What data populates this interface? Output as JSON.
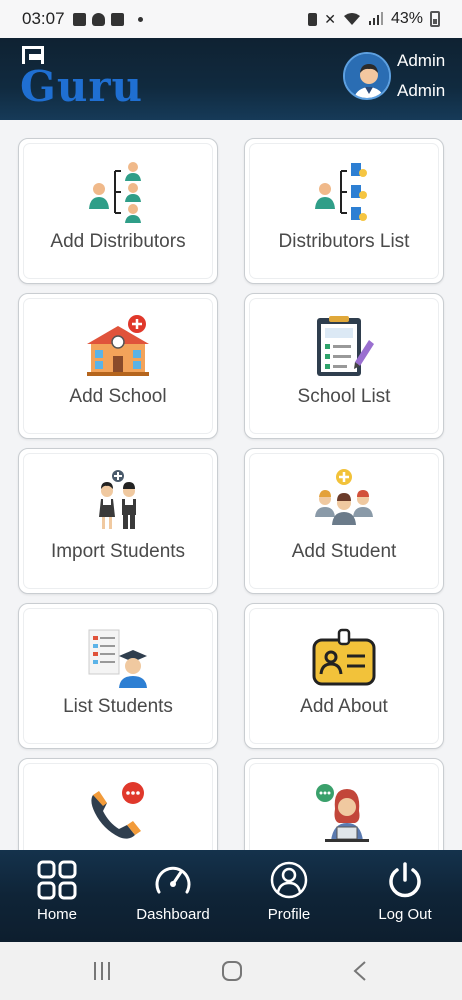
{
  "status_bar": {
    "time": "03:07",
    "battery": "43%"
  },
  "header": {
    "brand": "Guru",
    "user_name": "Admin",
    "user_role": "Admin"
  },
  "cards": [
    {
      "label": "Add Distributors",
      "icon": "add-distributors-icon"
    },
    {
      "label": "Distributors List",
      "icon": "distributors-list-icon"
    },
    {
      "label": "Add School",
      "icon": "add-school-icon"
    },
    {
      "label": "School List",
      "icon": "school-list-icon"
    },
    {
      "label": "Import Students",
      "icon": "import-students-icon"
    },
    {
      "label": "Add Student",
      "icon": "add-student-icon"
    },
    {
      "label": "List Students",
      "icon": "list-students-icon"
    },
    {
      "label": "Add About",
      "icon": "add-about-icon"
    },
    {
      "label": "",
      "icon": "contact-phone-icon"
    },
    {
      "label": "",
      "icon": "support-agent-icon"
    }
  ],
  "bottom_nav": [
    {
      "label": "Home",
      "icon": "home-grid-icon"
    },
    {
      "label": "Dashboard",
      "icon": "dashboard-gauge-icon"
    },
    {
      "label": "Profile",
      "icon": "profile-icon"
    },
    {
      "label": "Log Out",
      "icon": "power-icon"
    }
  ],
  "colors": {
    "header": "#102a3f",
    "brand": "#1f6fd2",
    "nav": "#0f2437"
  }
}
